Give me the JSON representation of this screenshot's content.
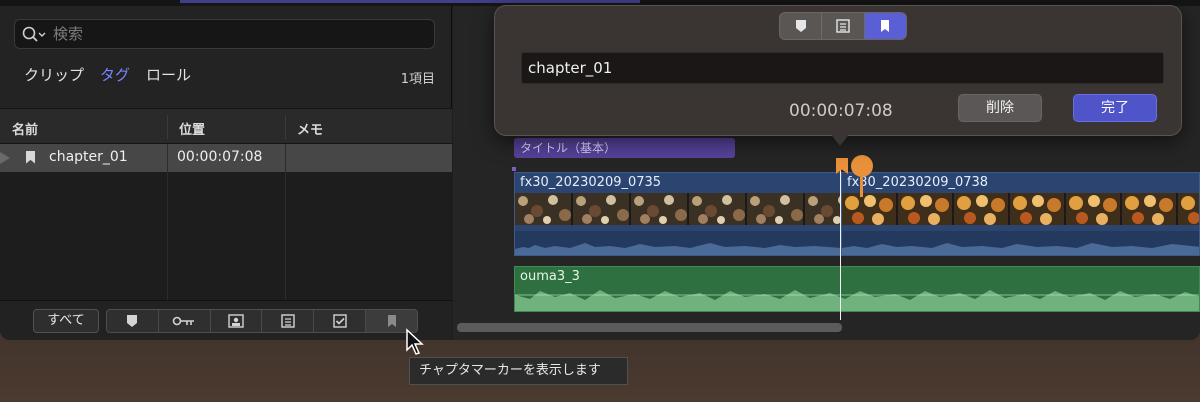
{
  "colors": {
    "accent": "#5a5fd6",
    "marker": "#e8913a",
    "title_clip": "#57429a",
    "video_clip": "#2b4570",
    "audio_clip": "#2f7040"
  },
  "index": {
    "search": {
      "placeholder": "検索",
      "value": ""
    },
    "tabs": [
      {
        "label": "クリップ",
        "active": false
      },
      {
        "label": "タグ",
        "active": true
      },
      {
        "label": "ロール",
        "active": false
      }
    ],
    "count": "1項目",
    "columns": [
      "名前",
      "位置",
      "メモ"
    ],
    "rows": [
      {
        "name": "chapter_01",
        "position": "00:00:07:08",
        "memo": ""
      }
    ],
    "footer": {
      "all_label": "すべて",
      "filter_icons": [
        "marker-icon",
        "keyword-icon",
        "analysis-icon",
        "todo-icon",
        "completed-icon",
        "chapter-icon"
      ]
    }
  },
  "timeline": {
    "title_clip": "タイトル（基本）",
    "video_clips": [
      "fx30_20230209_0735",
      "fx30_20230209_0738"
    ],
    "audio_clip": "ouma3_3"
  },
  "popover": {
    "type_icons": [
      "marker-icon",
      "todo-icon",
      "chapter-icon"
    ],
    "selected_type": "chapter-icon",
    "name_value": "chapter_01",
    "timecode": "00:00:07:08",
    "delete_label": "削除",
    "done_label": "完了"
  },
  "tooltip": "チャプタマーカーを表示します"
}
